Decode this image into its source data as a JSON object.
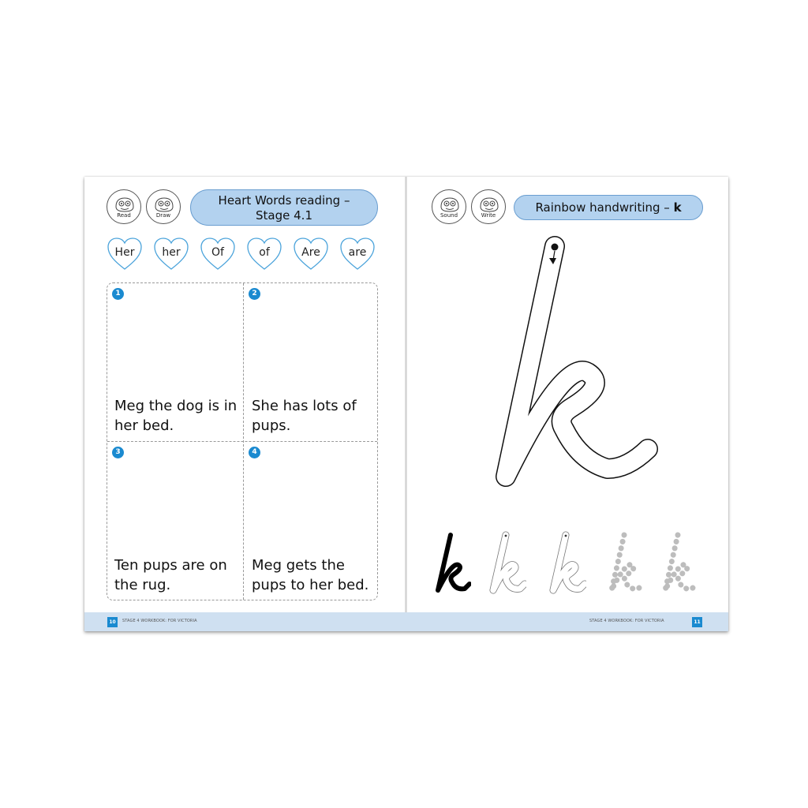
{
  "left_page": {
    "badges": [
      "Read",
      "Draw"
    ],
    "title_line1": "Heart Words reading –",
    "title_line2": "Stage 4.1",
    "hearts": [
      "Her",
      "her",
      "Of",
      "of",
      "Are",
      "are"
    ],
    "panels": [
      {
        "number": "1",
        "text": "Meg the dog is in her bed."
      },
      {
        "number": "2",
        "text": "She has lots of pups."
      },
      {
        "number": "3",
        "text": "Ten pups are on the rug."
      },
      {
        "number": "4",
        "text": "Meg gets the pups to her bed."
      }
    ],
    "page_number": "10",
    "footer_text": "STAGE 4 WORKBOOK: FOR VICTORIA"
  },
  "right_page": {
    "badges": [
      "Sound",
      "Write"
    ],
    "title": "Rainbow handwriting – ",
    "title_letter": "k",
    "page_number": "11",
    "footer_text": "STAGE 4 WORKBOOK: FOR VICTORIA"
  },
  "colors": {
    "accent_blue": "#1a8ad0",
    "pill_fill": "#b3d2ef",
    "footer_band": "#cfe0f1"
  },
  "icons": [
    "owl-mascot-icon",
    "heart-outline-icon",
    "start-dot-arrow-icon"
  ]
}
